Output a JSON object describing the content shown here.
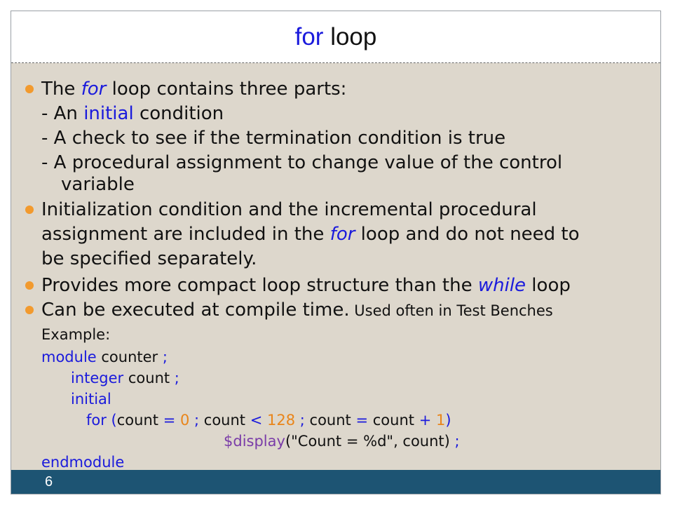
{
  "title": {
    "keyword": "for",
    "rest": " loop"
  },
  "bullet1": {
    "pre": "The ",
    "em": "for",
    "post": " loop contains three parts:",
    "part1_pre": "- An ",
    "part1_kw": "initial",
    "part1_post": " condition",
    "part2": "- A check to see if the termination condition is true",
    "part3": "- A procedural assignment to change value of the control",
    "part3_cont": "variable"
  },
  "bullet2": {
    "line1": "Initialization condition and the incremental procedural",
    "line2_pre": "assignment are included in the ",
    "line2_em": "for",
    "line2_post": " loop and do not need to",
    "line3": "be specified separately."
  },
  "bullet3": {
    "pre": "Provides more compact loop structure than the ",
    "em": "while",
    "post": " loop"
  },
  "bullet4": {
    "big": "Can be executed at compile time.",
    "small": " Used often in Test Benches"
  },
  "example_label": "Example:",
  "code": {
    "l1_kw": "module",
    "l1_id": " counter ",
    "l1_semi": ";",
    "l2_kw": "integer",
    "l2_id": " count ",
    "l2_semi": ";",
    "l3_kw": "initial",
    "l4": {
      "kw": "for",
      "p1": " (",
      "id1": "count ",
      "op1": "=",
      "n0": " 0",
      "s1": " ; ",
      "id2": "count ",
      "op2": "<",
      "n128": " 128",
      "s2": " ; ",
      "id3": "count ",
      "op3": "=",
      "id4": " count ",
      "op4": "+",
      "n1": " 1",
      "p2": ")"
    },
    "l5": {
      "fn": "$display",
      "p1": "(",
      "str": "\"Count = %d\"",
      "rest": ", count) ",
      "semi": ";"
    },
    "l6": "endmodule"
  },
  "page_number": "6"
}
